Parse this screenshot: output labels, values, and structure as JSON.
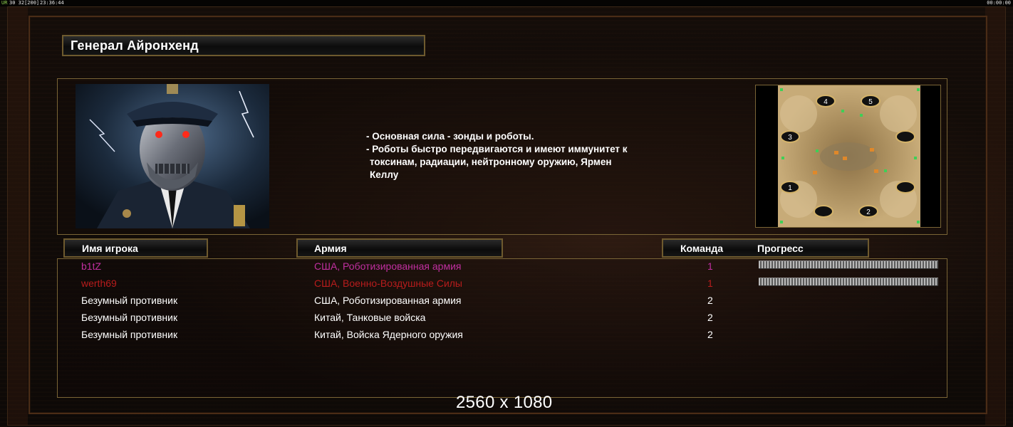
{
  "status_bar": {
    "ur_label": "UR",
    "fps": "30 32[200]",
    "clock": "23:36:44",
    "right_clock": "00:00:00"
  },
  "general": {
    "title": "Генерал Айронхенд",
    "description": [
      "- Основная сила - зонды и роботы.",
      "- Роботы быстро передвигаются и имеют иммунитет к",
      "токсинам, радиации, нейтронному оружию, Ярмен",
      "Келлу"
    ]
  },
  "minimap": {
    "start_positions": [
      "4",
      "5",
      "3",
      "1",
      "2"
    ]
  },
  "columns": {
    "name": "Имя игрока",
    "army": "Армия",
    "team": "Команда",
    "progress": "Прогресс"
  },
  "players": [
    {
      "name": "b1tZ",
      "army": "США, Роботизированная армия",
      "team": "1",
      "color": "#c02fa0",
      "progress": 1.0
    },
    {
      "name": "werth69",
      "army": "США, Военно-Воздушные Силы",
      "team": "1",
      "color": "#b81c1c",
      "progress": 1.0
    },
    {
      "name": "Безумный противник",
      "army": "США, Роботизированная армия",
      "team": "2",
      "color": "#ffffff"
    },
    {
      "name": "Безумный противник",
      "army": "Китай, Танковые войска",
      "team": "2",
      "color": "#ffffff"
    },
    {
      "name": "Безумный противник",
      "army": "Китай, Войска Ядерного оружия",
      "team": "2",
      "color": "#ffffff"
    }
  ],
  "resolution": "2560 x 1080",
  "colors": {
    "frame_gold": "#7a6536",
    "header_border": "#6e5a2e"
  }
}
